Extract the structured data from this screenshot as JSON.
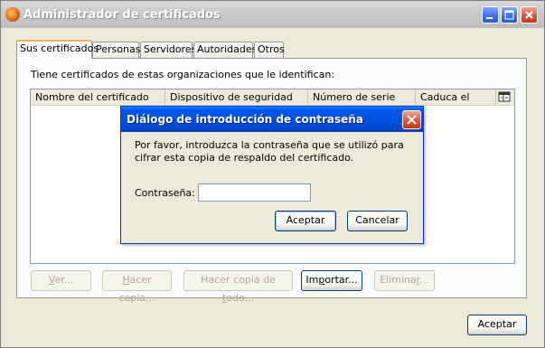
{
  "window": {
    "title": "Administrador de certificados",
    "icon": "firefox-icon"
  },
  "tabs": [
    {
      "label": "Sus certificados",
      "active": true
    },
    {
      "label": "Personas",
      "active": false
    },
    {
      "label": "Servidores",
      "active": false
    },
    {
      "label": "Autoridades",
      "active": false
    },
    {
      "label": "Otros",
      "active": false
    }
  ],
  "panel": {
    "intro": "Tiene certificados de estas organizaciones que le identifican:",
    "columns": [
      "Nombre del certificado",
      "Dispositivo de seguridad",
      "Número de serie",
      "Caduca el"
    ],
    "rows": []
  },
  "actions": {
    "view": {
      "label_pre": "",
      "accel": "V",
      "label_post": "er...",
      "enabled": false
    },
    "backup": {
      "label_pre": "",
      "accel": "H",
      "label_post": "acer copia...",
      "enabled": false
    },
    "backup_all": {
      "label_pre": "Hacer copia de ",
      "accel": "t",
      "label_post": "odo...",
      "enabled": false
    },
    "import": {
      "label_pre": "Im",
      "accel": "p",
      "label_post": "ortar...",
      "enabled": true
    },
    "delete": {
      "label_pre": "Elimina",
      "accel": "r",
      "label_post": "...",
      "enabled": false
    }
  },
  "ok_label": "Aceptar",
  "dialog": {
    "title": "Diálogo de introducción de contraseña",
    "message": "Por favor, introduzca la contraseña que se utilizó para cifrar esta copia de respaldo del certificado.",
    "password_label": "Contraseña:",
    "password_value": "",
    "ok_label": "Aceptar",
    "cancel_label": "Cancelar"
  },
  "colors": {
    "dialog_title": "#0054e3",
    "window_title_inactive": "#c9c9c9",
    "active_tab_accent": "#f6b54b"
  }
}
